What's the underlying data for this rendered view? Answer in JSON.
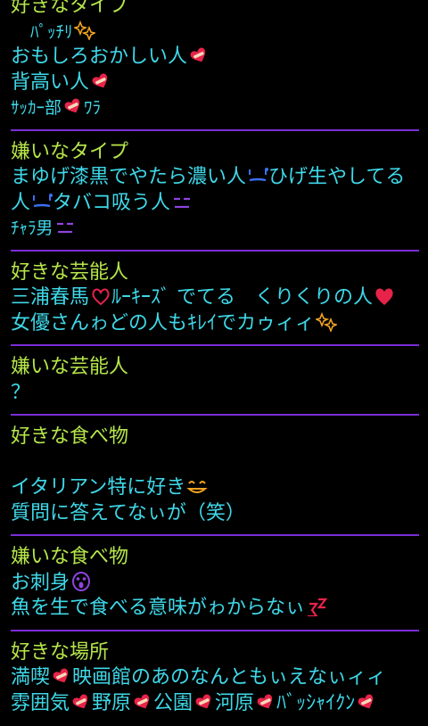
{
  "sections": [
    {
      "heading": "好きなタイプ",
      "lines": [
        {
          "text": "ﾊﾟｯﾁﾘ",
          "icon": "sparkle-icon",
          "small": true,
          "indent": true
        },
        {
          "text": "おもしろおかしい人",
          "icon": "heart-bandage-icon"
        },
        {
          "text": "背高い人",
          "icon": "heart-bandage-icon"
        },
        {
          "text": "ｻｯｶｰ部",
          "icon": "heart-bandage-icon",
          "tail": "ﾜﾗ",
          "small": true
        }
      ]
    },
    {
      "heading": "嫌いなタイプ",
      "lines": [
        {
          "text": "まゆげ漆黒でやたら濃い人",
          "icon": "sweat-face-icon",
          "tail": "ひげ生やしてる人",
          "icon2": "sweat-face-icon",
          "tail2": "タバコ吸う人",
          "icon3": "annoyed-face-icon",
          "wrap": true
        },
        {
          "text": "ﾁｬﾗ男",
          "icon": "annoyed-face-icon",
          "small": true
        }
      ]
    },
    {
      "heading": "好きな芸能人",
      "lines": [
        {
          "text": "三浦春馬",
          "icon": "heart-outline-icon",
          "tail": "ﾙｰｷｰｽﾞ でてる　くりくりの人",
          "icon2": "red-heart-icon"
        },
        {
          "text": "女優さんゎどの人もｷﾚｲでカゥィィ",
          "icon": "sparkle-icon"
        }
      ]
    },
    {
      "heading": "嫌いな芸能人",
      "lines": [
        {
          "text": "？"
        }
      ]
    },
    {
      "heading": "好きな食べ物",
      "lines": [
        {
          "text": ""
        },
        {
          "text": "イタリアン特に好き",
          "icon": "smile-face-icon"
        },
        {
          "text": "質問に答えてなぃが（笑）"
        }
      ]
    },
    {
      "heading": "嫌いな食べ物",
      "lines": [
        {
          "text": "お刺身",
          "icon": "scream-face-icon"
        },
        {
          "text": "魚を生で食べる意味がゎからなぃ",
          "icon": "sigh-icon"
        }
      ]
    },
    {
      "heading": "好きな場所",
      "lines": [
        {
          "text": "満喫",
          "icon": "heart-bandage-icon",
          "tail": "映画館のあのなんともぃえなぃィィ"
        },
        {
          "text": "雰囲気",
          "icon": "heart-bandage-icon",
          "tail": "野原",
          "icon2": "heart-bandage-icon",
          "tail2": "公園",
          "icon3": "heart-bandage-icon",
          "tail3": "河原",
          "icon4": "heart-bandage-icon",
          "tail4": "ﾊﾞｯｼｬｲｸﾝ",
          "icon5": "heart-bandage-icon"
        }
      ]
    }
  ],
  "colors": {
    "background": "#000000",
    "heading": "#b6e64a",
    "body_text": "#3fd8e8",
    "divider": "#7a2ed8",
    "heart": "#e8234a",
    "sparkle": "#f2a21e",
    "face_blue": "#3a6ff2",
    "face_purple": "#8e44e0",
    "face_orange": "#f2a21e"
  }
}
